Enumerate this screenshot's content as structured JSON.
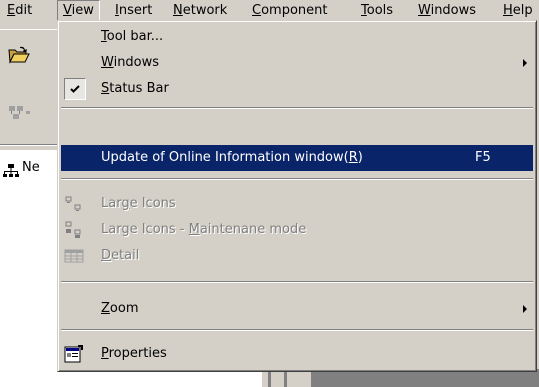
{
  "menubar": {
    "items": [
      {
        "label": "Edit",
        "mnemonic": "E",
        "rest": "dit"
      },
      {
        "label": "View",
        "mnemonic": "V",
        "rest": "iew"
      },
      {
        "label": "Insert",
        "mnemonic": "I",
        "rest": "nsert"
      },
      {
        "label": "Network",
        "mnemonic": "N",
        "rest": "etwork"
      },
      {
        "label": "Component",
        "mnemonic": "C",
        "rest": "omponent"
      },
      {
        "label": "Tools",
        "mnemonic": "T",
        "rest": "ools"
      },
      {
        "label": "Windows",
        "mnemonic": "W",
        "rest": "indows"
      },
      {
        "label": "Help",
        "mnemonic": "H",
        "rest": "elp"
      }
    ]
  },
  "tree": {
    "root_label": "Ne"
  },
  "view_menu": {
    "items": [
      {
        "mnemonic": "T",
        "rest": "ool bar...",
        "icon": "none"
      },
      {
        "mnemonic": "W",
        "rest": "indows",
        "icon": "none",
        "submenu": true
      },
      {
        "mnemonic": "S",
        "rest": "tatus Bar",
        "icon": "checkmark",
        "checked": true
      },
      {
        "label": "Update of Online Information window(",
        "mnemonic": "R",
        "suffix": ")",
        "accelerator": "F5",
        "highlighted": true
      },
      {
        "pre": "Lar",
        "mnemonic": "g",
        "rest": "e Icons",
        "icon": "large-icons-icon",
        "enabled": false
      },
      {
        "pre": "Large Icons - ",
        "mnemonic": "M",
        "rest": "aintenane mode",
        "icon": "large-icons-maintenance-icon",
        "enabled": false
      },
      {
        "mnemonic": "D",
        "rest": "etail",
        "icon": "detail-icon",
        "enabled": false
      },
      {
        "mnemonic": "Z",
        "rest": "oom",
        "icon": "none",
        "submenu": true
      },
      {
        "mnemonic": "P",
        "rest": "roperties",
        "icon": "properties-icon"
      }
    ]
  },
  "colors": {
    "menu_bg": "#d4d0c8",
    "highlight": "#0a246a",
    "disabled_text": "#808080"
  }
}
